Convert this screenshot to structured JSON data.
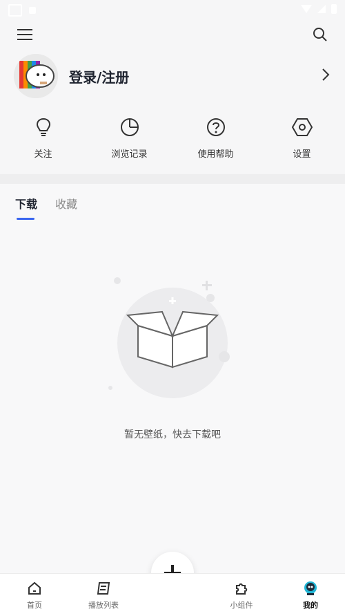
{
  "profile": {
    "login_label": "登录/注册"
  },
  "quick_actions": [
    {
      "label": "关注",
      "icon": "lightbulb-icon"
    },
    {
      "label": "浏览记录",
      "icon": "pie-chart-icon"
    },
    {
      "label": "使用帮助",
      "icon": "help-circle-icon"
    },
    {
      "label": "设置",
      "icon": "settings-hexagon-icon"
    }
  ],
  "tabs": [
    {
      "label": "下载",
      "active": true
    },
    {
      "label": "收藏",
      "active": false
    }
  ],
  "empty_state": {
    "message": "暂无壁纸，快去下载吧",
    "icon": "empty-box-icon"
  },
  "bottom_nav": [
    {
      "label": "首页",
      "icon": "home-icon",
      "active": false
    },
    {
      "label": "播放列表",
      "icon": "playlist-icon",
      "active": false
    },
    {
      "label": "小组件",
      "icon": "puzzle-icon",
      "active": false
    },
    {
      "label": "我的",
      "icon": "profile-icon",
      "active": true
    }
  ],
  "colors": {
    "accent": "#3a66f0",
    "background": "#f6f6f7",
    "nav_active": "#111111"
  }
}
